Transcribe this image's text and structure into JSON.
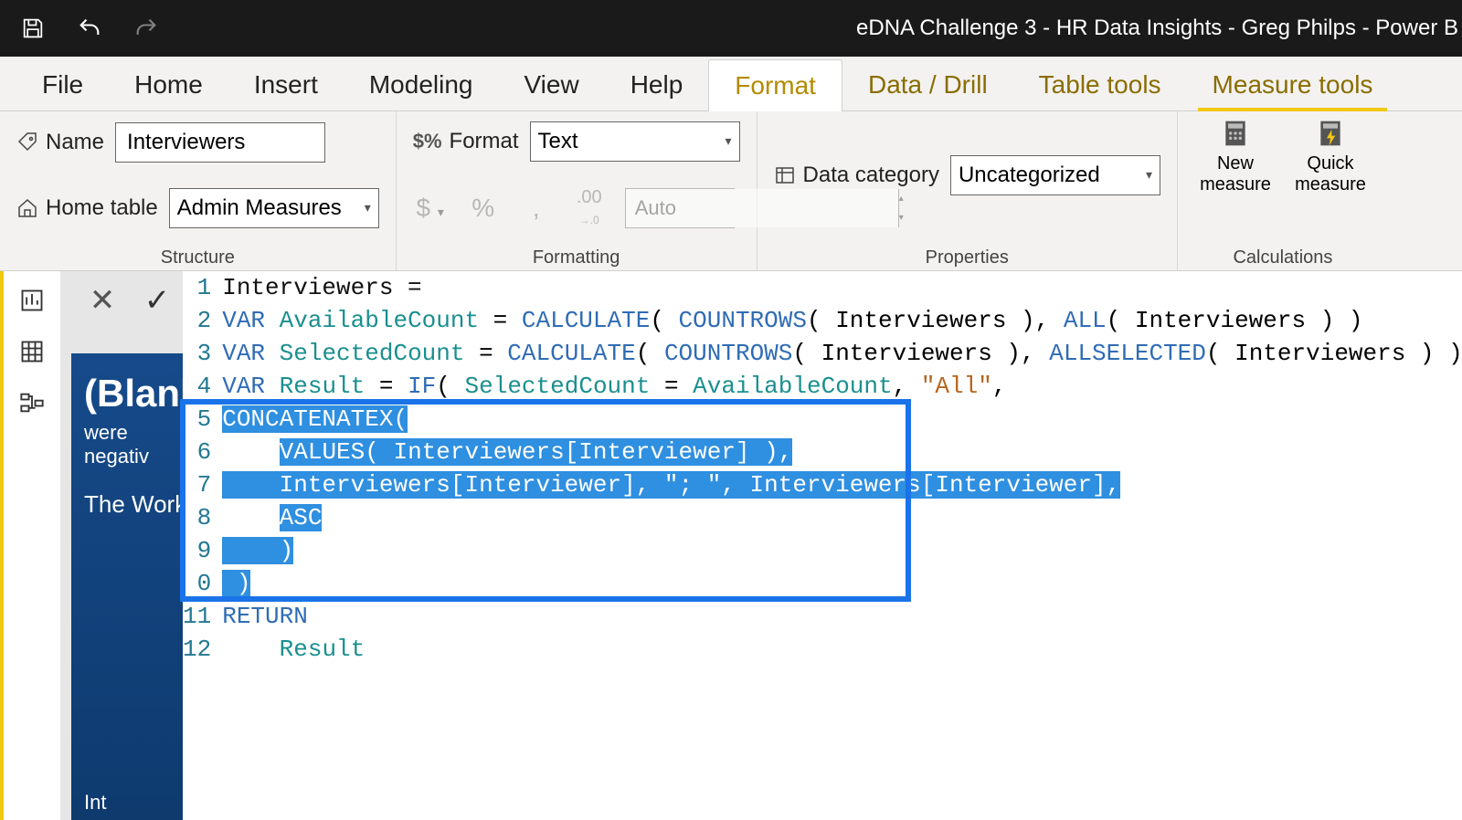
{
  "window": {
    "title": "eDNA Challenge 3 - HR Data Insights - Greg Philps - Power B"
  },
  "menus": {
    "file": "File",
    "home": "Home",
    "insert": "Insert",
    "modeling": "Modeling",
    "view": "View",
    "help": "Help",
    "format": "Format",
    "data_drill": "Data / Drill",
    "table_tools": "Table tools",
    "measure_tools": "Measure tools"
  },
  "ribbon": {
    "structure": {
      "label": "Structure",
      "name_label": "Name",
      "name_value": "Interviewers",
      "home_table_label": "Home table",
      "home_table_value": "Admin Measures"
    },
    "formatting": {
      "label": "Formatting",
      "format_label": "Format",
      "format_value": "Text",
      "decimal_value": "Auto"
    },
    "properties": {
      "label": "Properties",
      "category_label": "Data category",
      "category_value": "Uncategorized"
    },
    "calculations": {
      "label": "Calculations",
      "new_measure": "New measure",
      "quick_measure": "Quick measure"
    }
  },
  "report_bg": {
    "blank": "(Blank)",
    "neg": "were negativ",
    "work_line": "The Worki",
    "int": "Int"
  },
  "code": {
    "l1_a": "Interviewers = ",
    "l2_var": "VAR ",
    "l2_name": "AvailableCount",
    "l2_eq": " = ",
    "l2_f1": "CALCULATE",
    "l2_p1": "( ",
    "l2_f2": "COUNTROWS",
    "l2_p2": "( Interviewers ), ",
    "l2_f3": "ALL",
    "l2_p3": "( Interviewers ) )",
    "l3_var": "VAR ",
    "l3_name": "SelectedCount",
    "l3_eq": " = ",
    "l3_f1": "CALCULATE",
    "l3_p1": "( ",
    "l3_f2": "COUNTROWS",
    "l3_p2": "( Interviewers ), ",
    "l3_f3": "ALLSELECTED",
    "l3_p3": "( Interviewers ) )",
    "l4_var": "VAR ",
    "l4_name": "Result",
    "l4_eq": " = ",
    "l4_f1": "IF",
    "l4_p1": "( ",
    "l4_n2": "SelectedCount",
    "l4_eq2": " = ",
    "l4_n3": "AvailableCount",
    "l4_c": ", ",
    "l4_str": "\"All\"",
    "l4_end": ",",
    "l5_f": "CONCATENATEX",
    "l5_p": "(",
    "l6_pre": "    ",
    "l6_f": "VALUES",
    "l6_p": "( Interviewers[Interviewer] ),",
    "l7": "    Interviewers[Interviewer], \"; \", Interviewers[Interviewer],",
    "l8_pre": "    ",
    "l8": "ASC",
    "l9": "    )",
    "l10": " )",
    "l11": "RETURN",
    "l12_pre": "    ",
    "l12": "Result",
    "line_numbers": [
      "1",
      "2",
      "3",
      "4",
      "5",
      "6",
      "7",
      "8",
      "9",
      "0",
      "11",
      "12"
    ]
  }
}
